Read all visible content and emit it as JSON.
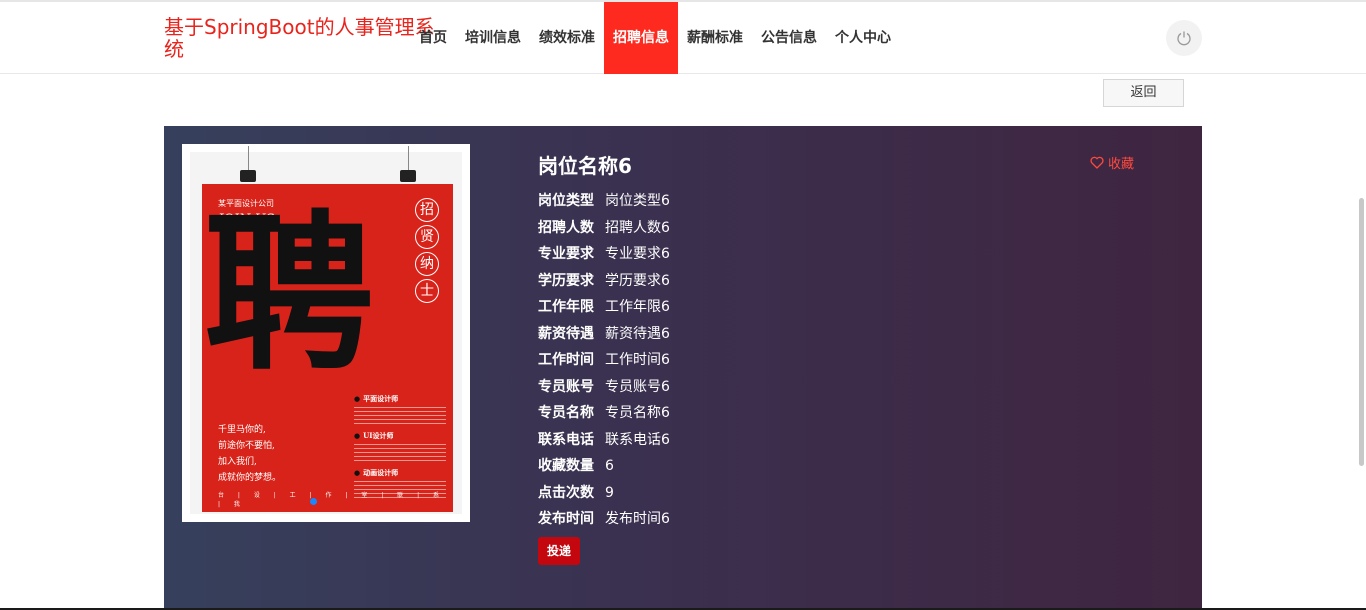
{
  "header": {
    "brand": "基于SpringBoot的人事管理系统",
    "nav": [
      {
        "label": "首页",
        "active": false
      },
      {
        "label": "培训信息",
        "active": false
      },
      {
        "label": "绩效标准",
        "active": false
      },
      {
        "label": "招聘信息",
        "active": true
      },
      {
        "label": "薪酬标准",
        "active": false
      },
      {
        "label": "公告信息",
        "active": false
      },
      {
        "label": "个人中心",
        "active": false
      }
    ],
    "power_icon": "power-icon"
  },
  "back_label": "返回",
  "poster": {
    "sub": "某平面设计公司",
    "join": "JOIN US",
    "vertical": [
      "招",
      "贤",
      "纳",
      "士"
    ],
    "big_char": "聘",
    "left_lines": [
      "千里马你的,",
      "前途你不要怕,",
      "加入我们,",
      "成就你的梦想。"
    ],
    "jobs": [
      "平面设计师",
      "UI设计师",
      "动画设计师"
    ],
    "footer": "台 | 设 | 工 | 作 | 室 | 联 | 系 | 我"
  },
  "detail": {
    "title": "岗位名称6",
    "favorite_label": "收藏",
    "fields": [
      {
        "label": "岗位类型",
        "value": "岗位类型6"
      },
      {
        "label": "招聘人数",
        "value": "招聘人数6"
      },
      {
        "label": "专业要求",
        "value": "专业要求6"
      },
      {
        "label": "学历要求",
        "value": "学历要求6"
      },
      {
        "label": "工作年限",
        "value": "工作年限6"
      },
      {
        "label": "薪资待遇",
        "value": "薪资待遇6"
      },
      {
        "label": "工作时间",
        "value": "工作时间6"
      },
      {
        "label": "专员账号",
        "value": "专员账号6"
      },
      {
        "label": "专员名称",
        "value": "专员名称6"
      },
      {
        "label": "联系电话",
        "value": "联系电话6"
      },
      {
        "label": "收藏数量",
        "value": "6"
      },
      {
        "label": "点击次数",
        "value": "9"
      },
      {
        "label": "发布时间",
        "value": "发布时间6"
      }
    ],
    "apply_label": "投递"
  },
  "colors": {
    "accent": "#ff2a1f",
    "brand": "#e8241c",
    "apply": "#c4060e"
  }
}
